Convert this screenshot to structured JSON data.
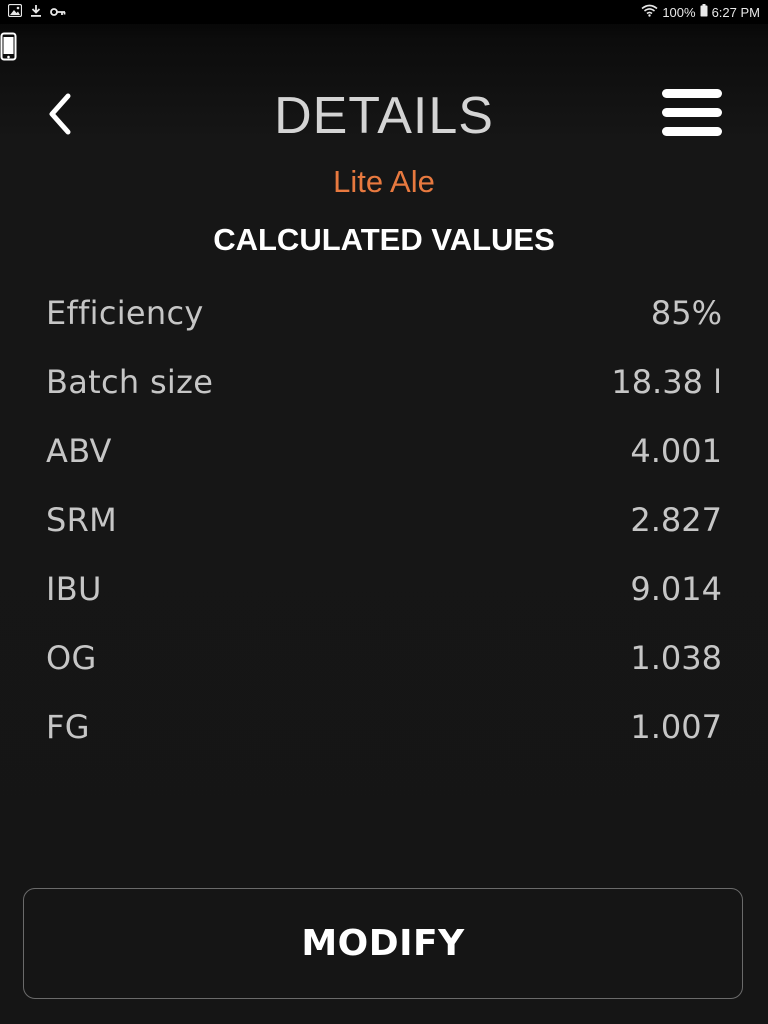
{
  "status_bar": {
    "left_icons": [
      "gallery-icon",
      "download-icon",
      "key-icon"
    ],
    "battery": "100%",
    "time": "6:27 PM",
    "right_icons": [
      "wifi-icon",
      "battery-icon"
    ]
  },
  "header": {
    "title": "DETAILS",
    "subtitle": "Lite Ale",
    "back_icon": "chevron-left-icon",
    "menu_icon": "hamburger-menu-icon"
  },
  "section": {
    "title": "CALCULATED VALUES"
  },
  "values": [
    {
      "label": "Efficiency",
      "value": "85%"
    },
    {
      "label": "Batch size",
      "value": "18.38 l"
    },
    {
      "label": "ABV",
      "value": "4.001"
    },
    {
      "label": "SRM",
      "value": "2.827"
    },
    {
      "label": "IBU",
      "value": "9.014"
    },
    {
      "label": "OG",
      "value": "1.038"
    },
    {
      "label": "FG",
      "value": "1.007"
    }
  ],
  "actions": {
    "modify_label": "MODIFY"
  },
  "colors": {
    "background": "#151515",
    "accent": "#e8793f",
    "text_primary": "#ffffff",
    "text_secondary": "#c6c6c6",
    "title": "#d4d4d4"
  }
}
